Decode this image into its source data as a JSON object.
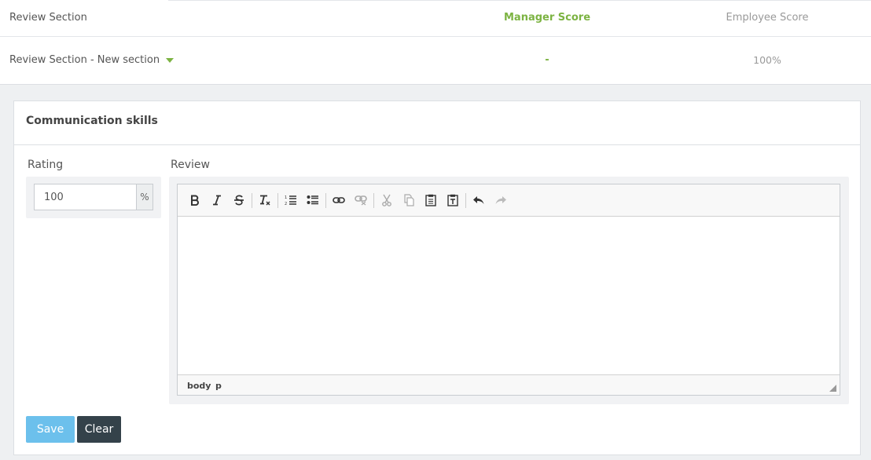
{
  "summary": {
    "headers": {
      "section": "Review Section",
      "manager": "Manager Score",
      "employee": "Employee Score"
    },
    "row": {
      "section": "Review Section - New section",
      "manager": "-",
      "employee": "100%"
    }
  },
  "card": {
    "title": "Communication skills",
    "rating_label": "Rating",
    "rating_value": "100",
    "rating_unit": "%",
    "review_label": "Review",
    "editor": {
      "toolbar": [
        "bold-icon",
        "italic-icon",
        "strikethrough-icon",
        "remove-format-icon",
        "numbered-list-icon",
        "bulleted-list-icon",
        "link-icon",
        "unlink-icon",
        "cut-icon",
        "copy-icon",
        "paste-icon",
        "paste-text-icon",
        "undo-icon",
        "redo-icon"
      ],
      "path": [
        "body",
        "p"
      ]
    },
    "save_label": "Save",
    "clear_label": "Clear"
  },
  "colors": {
    "accent_green": "#7cb342",
    "save_blue": "#6cc0ec",
    "clear_dark": "#34424a"
  }
}
